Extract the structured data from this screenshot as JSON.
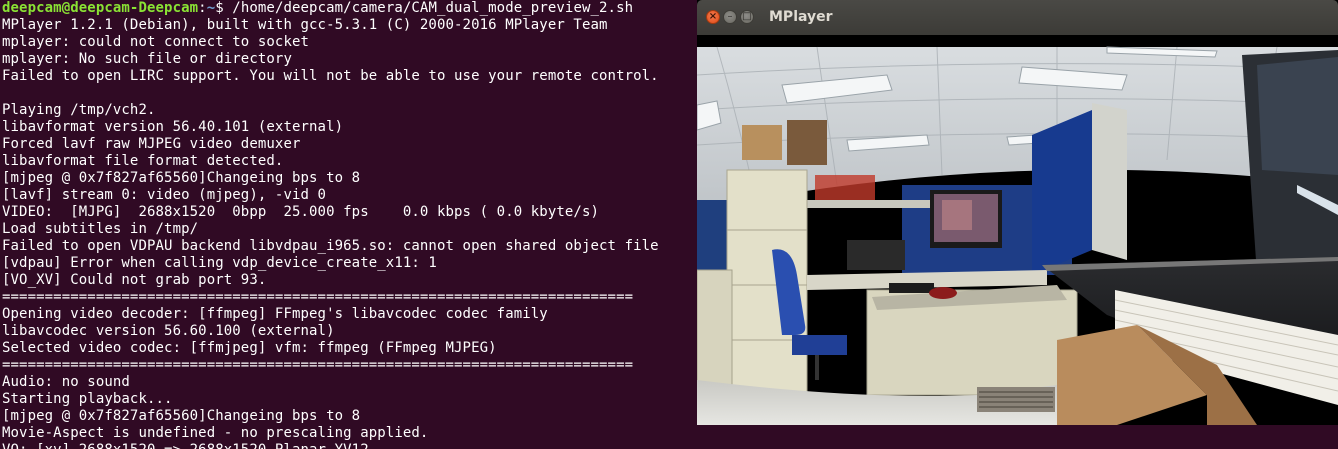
{
  "terminal": {
    "prompt": {
      "user_host": "deepcam@deepcam-Deepcam",
      "separator": ":",
      "path": "~",
      "symbol": "$ ",
      "command": "/home/deepcam/camera/CAM_dual_mode_preview_2.sh"
    },
    "lines": [
      "MPlayer 1.2.1 (Debian), built with gcc-5.3.1 (C) 2000-2016 MPlayer Team",
      "mplayer: could not connect to socket",
      "mplayer: No such file or directory",
      "Failed to open LIRC support. You will not be able to use your remote control.",
      "",
      "Playing /tmp/vch2.",
      "libavformat version 56.40.101 (external)",
      "Forced lavf raw MJPEG video demuxer",
      "libavformat file format detected.",
      "[mjpeg @ 0x7f827af65560]Changeing bps to 8",
      "[lavf] stream 0: video (mjpeg), -vid 0",
      "VIDEO:  [MJPG]  2688x1520  0bpp  25.000 fps    0.0 kbps ( 0.0 kbyte/s)",
      "Load subtitles in /tmp/",
      "Failed to open VDPAU backend libvdpau_i965.so: cannot open shared object file",
      "[vdpau] Error when calling vdp_device_create_x11: 1",
      "[VO_XV] Could not grab port 93.",
      "==========================================================================",
      "Opening video decoder: [ffmpeg] FFmpeg's libavcodec codec family",
      "libavcodec version 56.60.100 (external)",
      "Selected video codec: [ffmjpeg] vfm: ffmpeg (FFmpeg MJPEG)",
      "==========================================================================",
      "Audio: no sound",
      "Starting playback...",
      "[mjpeg @ 0x7f827af65560]Changeing bps to 8",
      "Movie-Aspect is undefined - no prescaling applied.",
      "VO: [xv] 2688x1520 => 2688x1520 Planar YV12"
    ],
    "colors": {
      "background": "#300a24",
      "text": "#ffffff",
      "prompt_user": "#8ae234",
      "prompt_path": "#729fcf"
    }
  },
  "mplayer_window": {
    "title": "MPlayer",
    "buttons": {
      "close_icon": "close-icon",
      "minimize_icon": "minimize-icon",
      "maximize_icon": "maximize-icon",
      "close_glyph": "×",
      "minimize_glyph": "–",
      "maximize_glyph": "□"
    },
    "video": {
      "description_icon": "camera-frame"
    }
  }
}
